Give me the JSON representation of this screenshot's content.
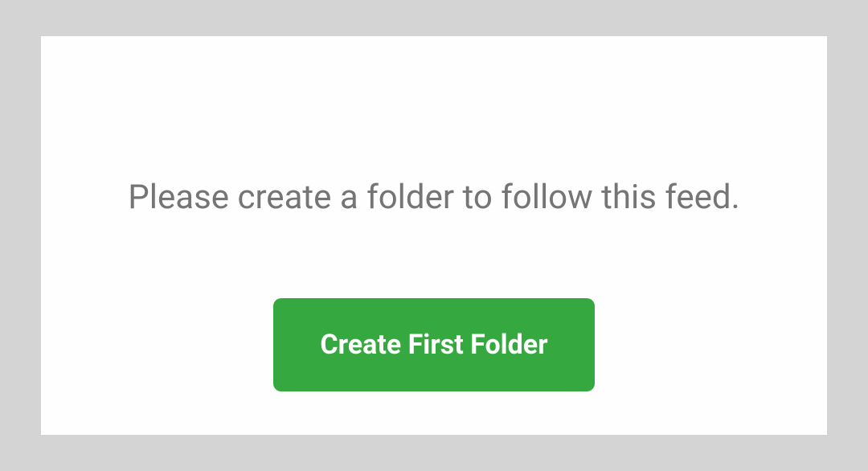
{
  "card": {
    "message": "Please create a folder to follow this feed.",
    "button_label": "Create First Folder"
  }
}
